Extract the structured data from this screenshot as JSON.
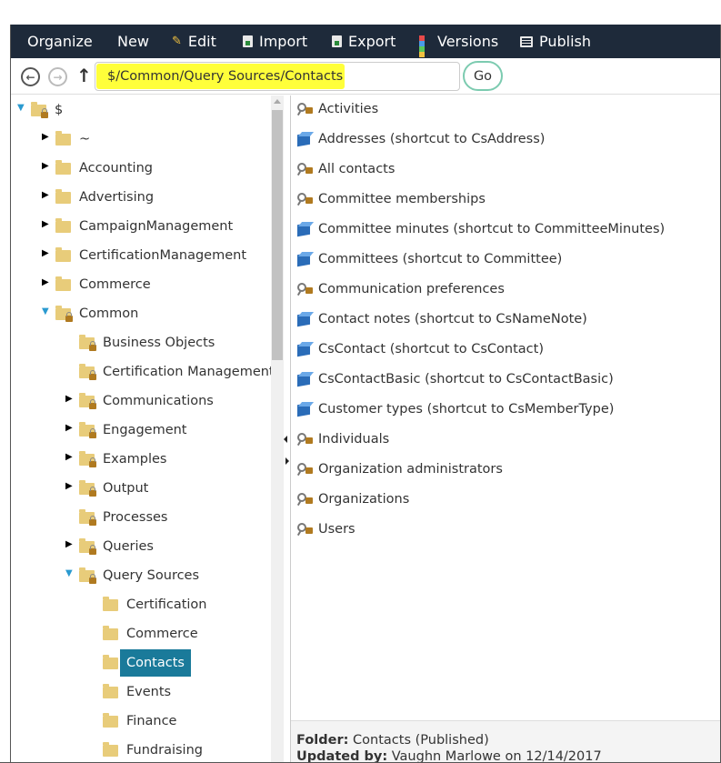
{
  "toolbar": {
    "organize": "Organize",
    "new": "New",
    "edit": "Edit",
    "import": "Import",
    "export": "Export",
    "versions": "Versions",
    "publish": "Publish"
  },
  "address": {
    "path": "$/Common/Query Sources/Contacts",
    "go": "Go"
  },
  "tree": {
    "root": "$",
    "items": [
      {
        "label": "~"
      },
      {
        "label": "Accounting"
      },
      {
        "label": "Advertising"
      },
      {
        "label": "CampaignManagement"
      },
      {
        "label": "CertificationManagement"
      },
      {
        "label": "Commerce"
      },
      {
        "label": "Common"
      },
      {
        "label": "Business Objects"
      },
      {
        "label": "Certification Management"
      },
      {
        "label": "Communications"
      },
      {
        "label": "Engagement"
      },
      {
        "label": "Examples"
      },
      {
        "label": "Output"
      },
      {
        "label": "Processes"
      },
      {
        "label": "Queries"
      },
      {
        "label": "Query Sources"
      },
      {
        "label": "Certification"
      },
      {
        "label": "Commerce"
      },
      {
        "label": "Contacts"
      },
      {
        "label": "Events"
      },
      {
        "label": "Finance"
      },
      {
        "label": "Fundraising"
      }
    ]
  },
  "list": {
    "items": [
      {
        "label": "Activities",
        "icon": "query-icon"
      },
      {
        "label": "Addresses (shortcut to CsAddress)",
        "icon": "shortcut-icon"
      },
      {
        "label": "All contacts",
        "icon": "query-icon"
      },
      {
        "label": "Committee memberships",
        "icon": "query-icon"
      },
      {
        "label": "Committee minutes (shortcut to CommitteeMinutes)",
        "icon": "shortcut-icon"
      },
      {
        "label": "Committees (shortcut to Committee)",
        "icon": "shortcut-icon"
      },
      {
        "label": "Communication preferences",
        "icon": "query-icon"
      },
      {
        "label": "Contact notes (shortcut to CsNameNote)",
        "icon": "shortcut-icon"
      },
      {
        "label": "CsContact (shortcut to CsContact)",
        "icon": "shortcut-icon"
      },
      {
        "label": "CsContactBasic (shortcut to CsContactBasic)",
        "icon": "shortcut-icon"
      },
      {
        "label": "Customer types (shortcut to CsMemberType)",
        "icon": "shortcut-icon"
      },
      {
        "label": "Individuals",
        "icon": "query-icon"
      },
      {
        "label": "Organization administrators",
        "icon": "query-icon"
      },
      {
        "label": "Organizations",
        "icon": "query-icon"
      },
      {
        "label": "Users",
        "icon": "query-icon"
      }
    ]
  },
  "footer": {
    "folder_label": "Folder:",
    "folder_value": "Contacts (Published)",
    "updated_label": "Updated by:",
    "updated_value": "Vaughn Marlowe on 12/14/2017"
  },
  "colors": {
    "toolbar_bg": "#1e2a3a",
    "highlight": "#ffff3a",
    "selected": "#1a7a9a",
    "folder": "#e8cc7a"
  }
}
